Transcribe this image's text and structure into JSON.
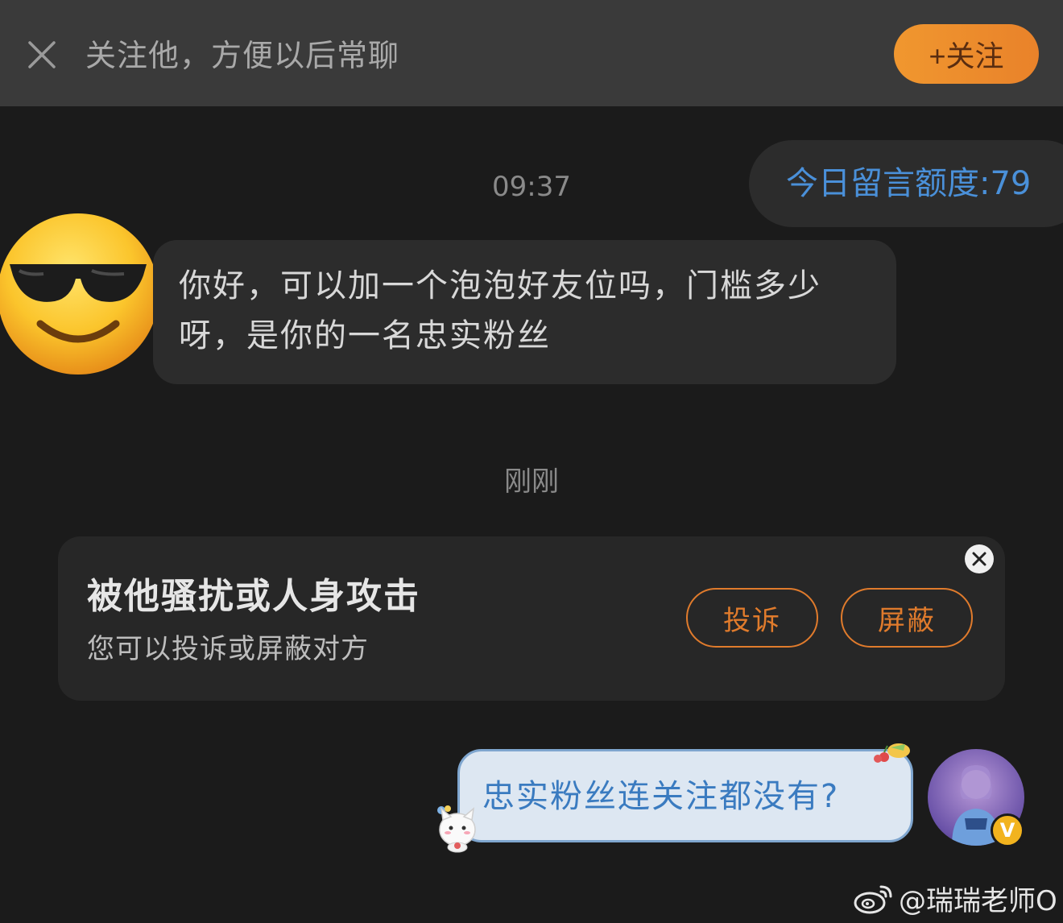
{
  "banner": {
    "text": "关注他，方便以后常聊",
    "follow_button": "+关注"
  },
  "quota": {
    "text": "今日留言额度:79"
  },
  "timestamps": {
    "first": "09:37",
    "second": "刚刚"
  },
  "incoming_message": {
    "text": "你好，可以加一个泡泡好友位吗，门槛多少呀，是你的一名忠实粉丝"
  },
  "safety_card": {
    "title": "被他骚扰或人身攻击",
    "subtitle": "您可以投诉或屏蔽对方",
    "report_button": "投诉",
    "block_button": "屏蔽"
  },
  "outgoing_message": {
    "text": "忠实粉丝连关注都没有?"
  },
  "user_avatar": {
    "verified_badge": "V"
  },
  "watermark": {
    "text": "@瑞瑞老师O"
  },
  "colors": {
    "background": "#1b1b1b",
    "banner": "#3a3a3a",
    "accent_orange": "#e07b2c",
    "quota_blue": "#4a90d9",
    "outgoing_bubble": "#dde7f2"
  }
}
